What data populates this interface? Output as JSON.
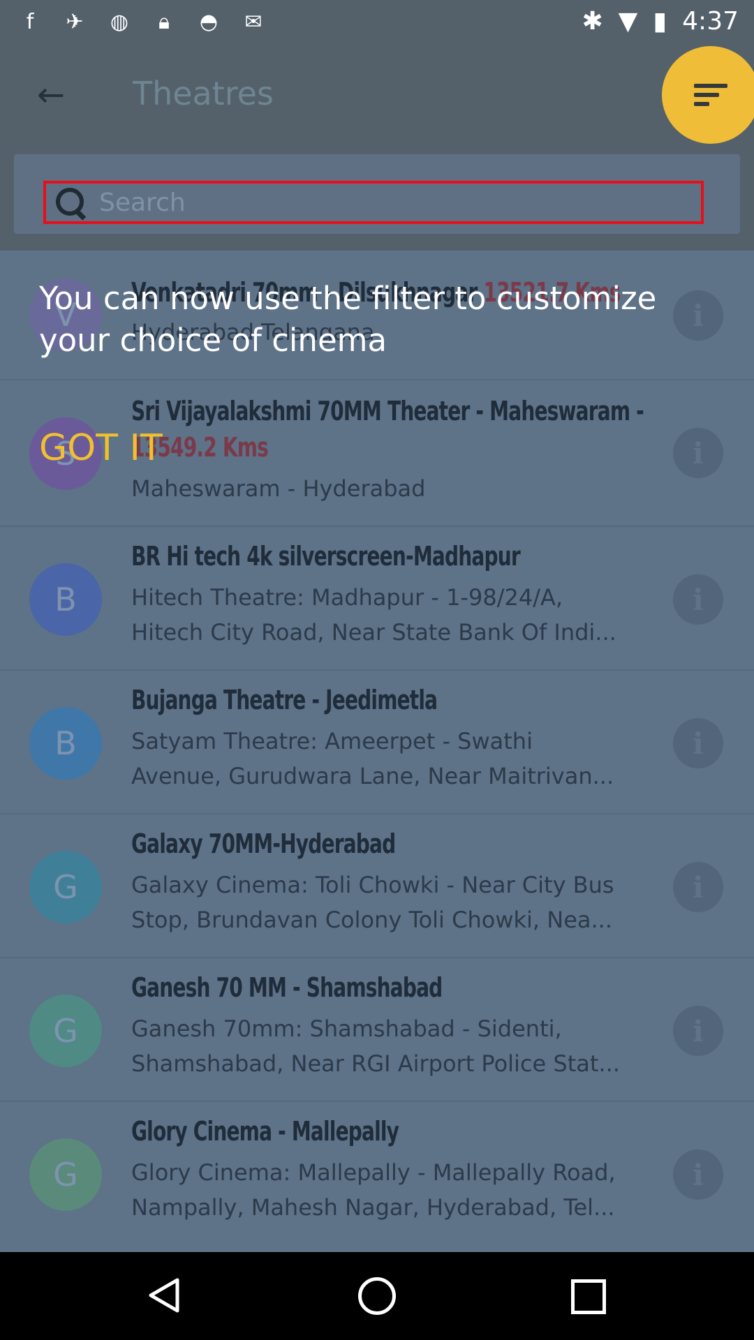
{
  "status_bar": {
    "time": "4:37",
    "left_icons": [
      "facebook-icon",
      "satellite-icon",
      "data-saver-icon",
      "lock-icon",
      "android-icon",
      "inbox-check-icon"
    ],
    "right_icons": [
      "bluetooth-icon",
      "wifi-icon",
      "battery-icon"
    ]
  },
  "app_bar": {
    "title": "Theatres",
    "back_icon": "arrow-back-icon",
    "filter_icon": "filter-icon",
    "fab_color": "#efbd37"
  },
  "search": {
    "placeholder": "Search"
  },
  "overlay": {
    "message": "You can now use the filter to customize your choice of cinema",
    "dismiss_label": "GOT IT"
  },
  "theatres": [
    {
      "initial": "V",
      "name": "Venkatadri 70mm - Dilsukhnagar",
      "distance": "13521.7 Kms",
      "address": "Hyderabad Telangana"
    },
    {
      "initial": "S",
      "name": "Sri Vijayalakshmi 70MM Theater - Maheswaram - ",
      "distance": "13549.2 Kms",
      "address": "Maheswaram - Hyderabad"
    },
    {
      "initial": "B",
      "name": "BR Hi tech 4k silverscreen-Madhapur",
      "address_line1": "Hitech Theatre: Madhapur - 1-98/24/A,",
      "address_line2": "Hitech City Road, Near State Bank Of Indi..."
    },
    {
      "initial": "B",
      "name": "Bujanga Theatre - Jeedimetla",
      "address_line1": "Satyam Theatre: Ameerpet - Swathi",
      "address_line2": "Avenue, Gurudwara Lane, Near Maitrivan..."
    },
    {
      "initial": "G",
      "name": "Galaxy 70MM-Hyderabad",
      "address_line1": "Galaxy Cinema: Toli Chowki - Near City Bus",
      "address_line2": "Stop, Brundavan Colony Toli Chowki, Nea..."
    },
    {
      "initial": "G",
      "name": "Ganesh 70 MM - Shamshabad",
      "address_line1": "Ganesh 70mm: Shamshabad - Sidenti,",
      "address_line2": "Shamshabad, Near RGI Airport Police Stat..."
    },
    {
      "initial": "G",
      "name": "Glory Cinema - Mallepally",
      "address_line1": "Glory Cinema: Mallepally - Mallepally Road,",
      "address_line2": "Nampally, Mahesh Nagar, Hyderabad, Tel..."
    }
  ],
  "colors": {
    "avatar_colors": [
      "#6a6a9a",
      "#6a5a9a",
      "#4a66a8",
      "#3f78a8",
      "#3f8098",
      "#4f8a85",
      "#5a8a7a"
    ]
  }
}
